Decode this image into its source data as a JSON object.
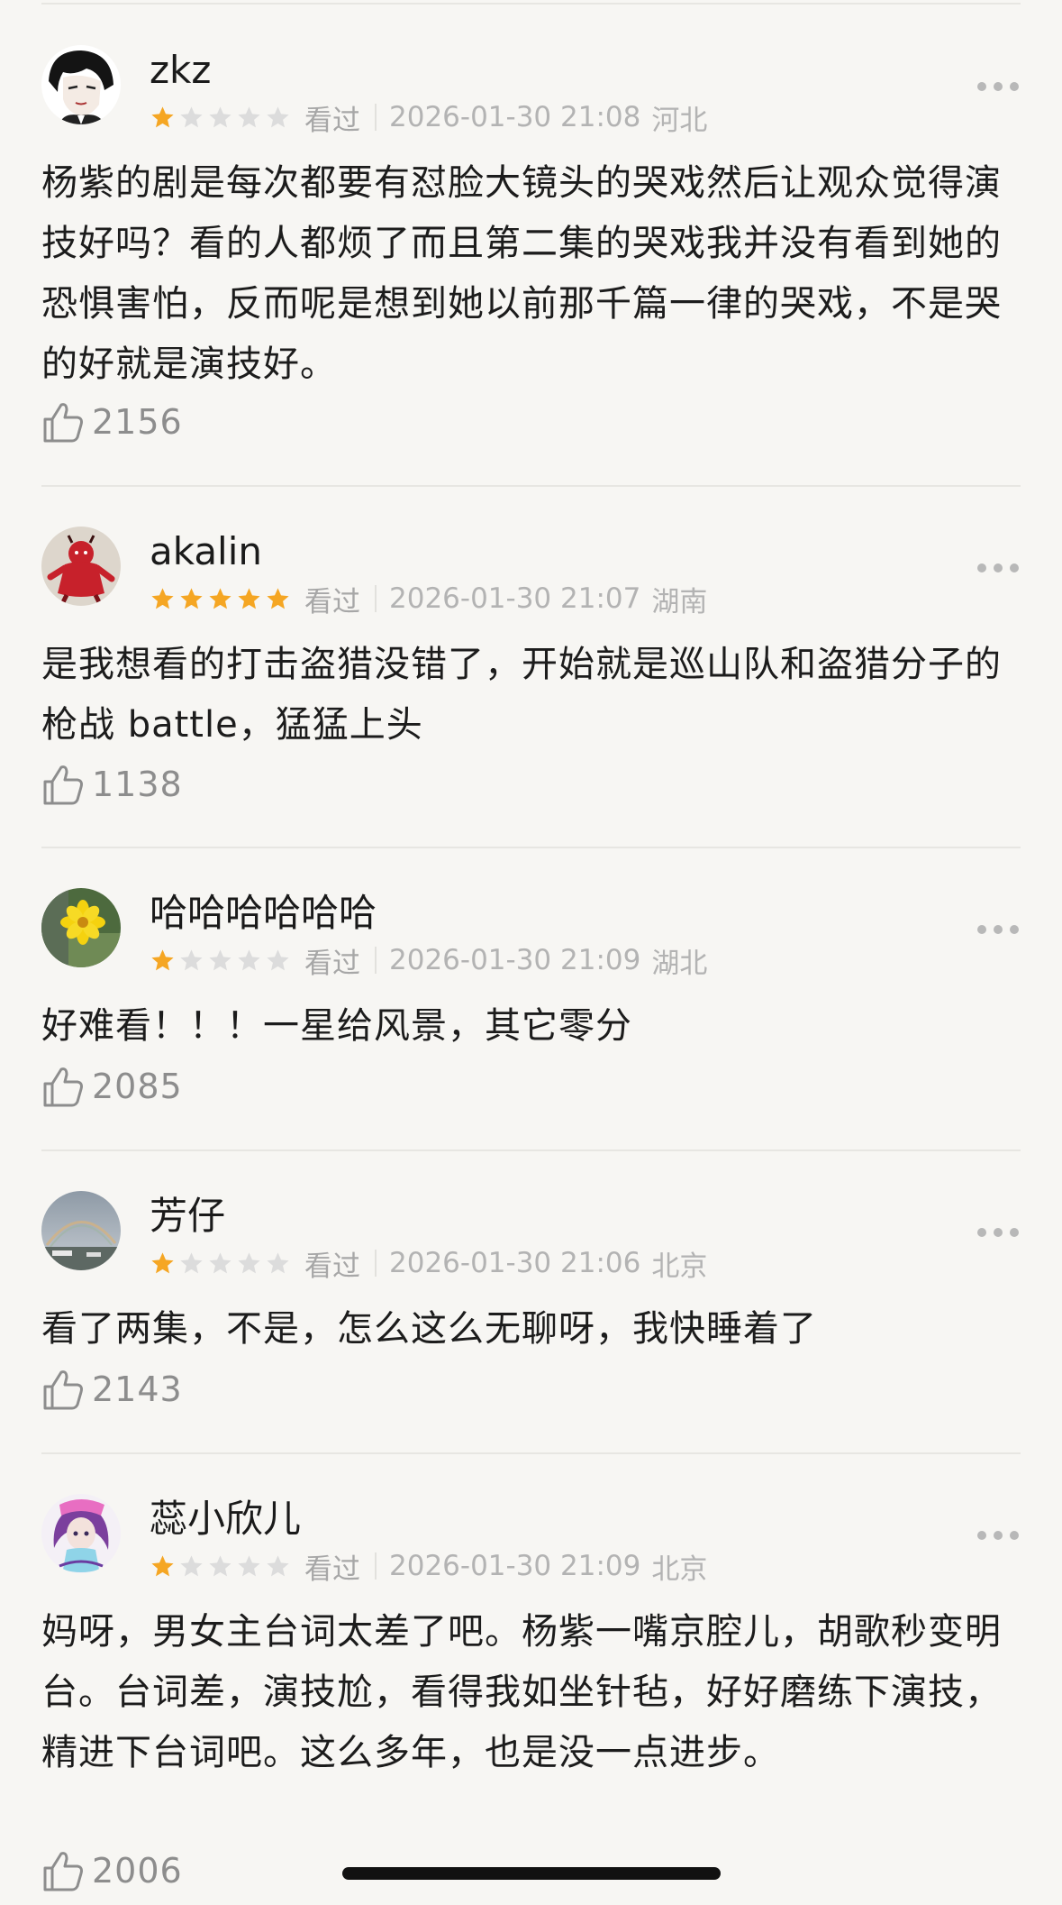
{
  "reviews": [
    {
      "username": "zkz",
      "rating": 1,
      "status": "看过",
      "datetime": "2026-01-30 21:08",
      "location": "河北",
      "content": "杨紫的剧是每次都要有怼脸大镜头的哭戏然后让观众觉得演技好吗？看的人都烦了而且第二集的哭戏我并没有看到她的恐惧害怕，反而呢是想到她以前那千篇一律的哭戏，不是哭的好就是演技好。",
      "likes": "2156",
      "avatar_icon": "anime-boy-avatar-icon"
    },
    {
      "username": "akalin",
      "rating": 5,
      "status": "看过",
      "datetime": "2026-01-30 21:07",
      "location": "湖南",
      "content": "是我想看的打击盗猎没错了，开始就是巡山队和盗猎分子的枪战 battle，猛猛上头",
      "likes": "1138",
      "avatar_icon": "red-figure-avatar-icon"
    },
    {
      "username": "哈哈哈哈哈哈",
      "rating": 1,
      "status": "看过",
      "datetime": "2026-01-30 21:09",
      "location": "湖北",
      "content": "好难看！！！一星给风景，其它零分",
      "likes": "2085",
      "avatar_icon": "yellow-flower-avatar-icon"
    },
    {
      "username": "芳仔",
      "rating": 1,
      "status": "看过",
      "datetime": "2026-01-30 21:06",
      "location": "北京",
      "content": "看了两集，不是，怎么这么无聊呀，我快睡着了",
      "likes": "2143",
      "avatar_icon": "rainbow-sky-avatar-icon"
    },
    {
      "username": "蕊小欣儿",
      "rating": 1,
      "status": "看过",
      "datetime": "2026-01-30 21:09",
      "location": "北京",
      "content": "妈呀，男女主台词太差了吧。杨紫一嘴京腔儿，胡歌秒变明台。台词差，演技尬，看得我如坐针毡，好好磨练下演技，精进下台词吧。这么多年，也是没一点进步。",
      "likes": "2006",
      "avatar_icon": "illustrated-girl-avatar-icon"
    }
  ],
  "colors": {
    "star_filled": "#f5a623",
    "star_empty": "#dcdcdc",
    "background": "#f7f6f3"
  }
}
